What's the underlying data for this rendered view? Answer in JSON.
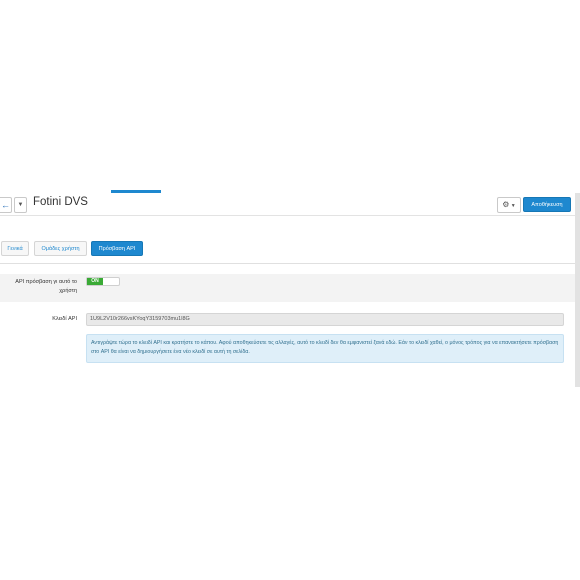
{
  "header": {
    "back_icon": "arrow-left-icon",
    "dropdown_icon": "caret-down-icon",
    "title": "Fotini DVS",
    "settings_icon": "gear-icon",
    "save_label": "Αποθήκευση",
    "accent_color": "#1e88cf"
  },
  "tabs": [
    {
      "label": "Γενικά",
      "active": false
    },
    {
      "label": "Ομάδες χρήστη",
      "active": false
    },
    {
      "label": "Πρόσβαση API",
      "active": true
    }
  ],
  "form": {
    "api_access_label": "API πρόσβαση γι αυτό το χρήστη",
    "api_access_toggle": "ON",
    "api_key_label": "Κλειδί API",
    "api_key_value": "1U9L2V10r266vsKYoqY3159703mu1l8G",
    "info_text": "Αντιγράψτε τώρα το κλειδί API και κρατήστε το κάπου. Αφού αποθηκεύσετε τις αλλαγές, αυτό το κλειδί δεν θα εμφανιστεί ξανά εδώ. Εάν το κλειδί χαθεί, ο μόνος τρόπος για να επανακτήσετε πρόσβαση στο API θα είναι να δημιουργήσετε ένα νέο κλειδί σε αυτή τη σελίδα."
  }
}
